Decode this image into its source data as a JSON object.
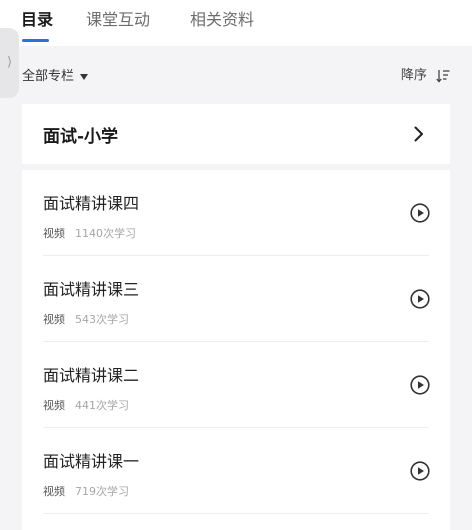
{
  "colors": {
    "accent": "#2f6fd6",
    "text_primary": "#1a1a1a",
    "text_secondary": "#6d6d6d",
    "background": "#f4f4f6"
  },
  "tabs": [
    {
      "label": "目录",
      "active": true
    },
    {
      "label": "课堂互动",
      "active": false
    },
    {
      "label": "相关资料",
      "active": false
    }
  ],
  "side_handle": {
    "icon": "chevron-right-icon",
    "glyph": "⟩"
  },
  "filter": {
    "label": "全部专栏",
    "dropdown_icon": "caret-down-icon",
    "sort_label": "降序",
    "sort_icon": "sort-descending-icon"
  },
  "section": {
    "title": "面试-小学",
    "icon": "chevron-right-icon"
  },
  "items": [
    {
      "title": "面试精讲课四",
      "type": "视频",
      "count": "1140次学习",
      "icon": "play-circle-icon"
    },
    {
      "title": "面试精讲课三",
      "type": "视频",
      "count": "543次学习",
      "icon": "play-circle-icon"
    },
    {
      "title": "面试精讲课二",
      "type": "视频",
      "count": "441次学习",
      "icon": "play-circle-icon"
    },
    {
      "title": "面试精讲课一",
      "type": "视频",
      "count": "719次学习",
      "icon": "play-circle-icon"
    }
  ]
}
